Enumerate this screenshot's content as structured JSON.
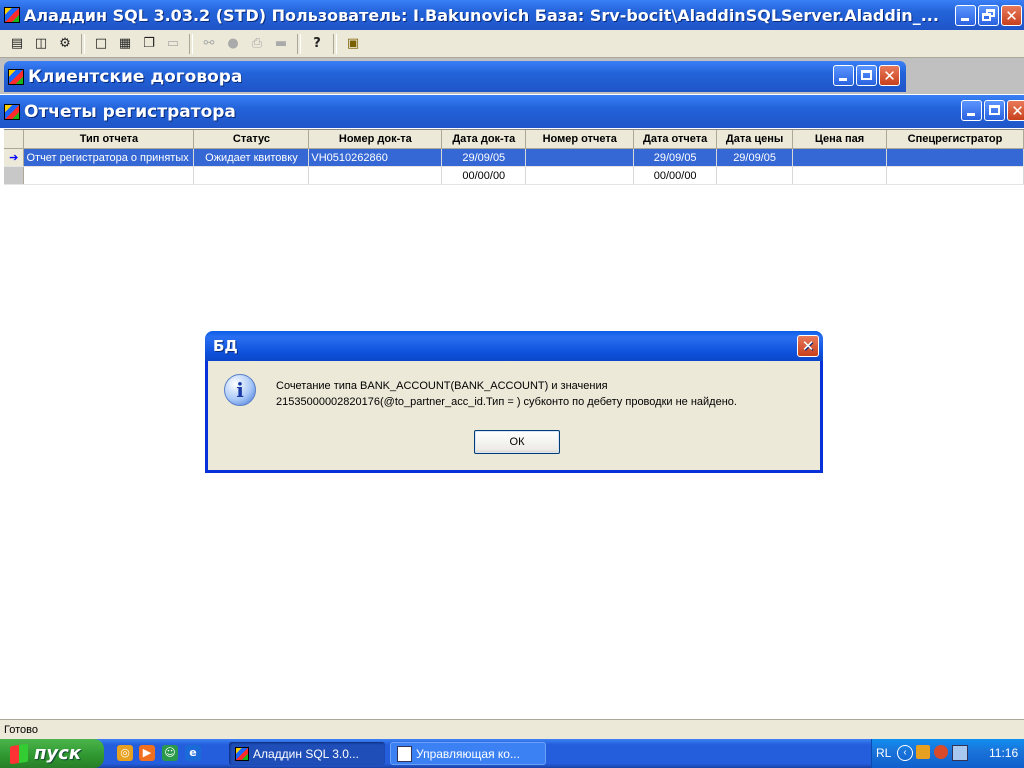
{
  "app": {
    "title": "Аладдин SQL 3.03.2 (STD)  Пользователь: I.Bakunovich База: Srv-bocit\\AladdinSQLServer.Aladdin_..."
  },
  "toolbar": {
    "icons": [
      "report-icon",
      "open-db-icon",
      "filter-icon",
      "window-icon",
      "tile-icon",
      "cascade-icon",
      "blank-window-icon",
      "binoculars-icon",
      "refresh-icon",
      "print-icon",
      "export-icon",
      "help-icon",
      "module-icon"
    ]
  },
  "windows": {
    "contracts_title": "Клиентские договора",
    "reports_title": "Отчеты регистратора"
  },
  "table": {
    "columns": [
      "Тип отчета",
      "Статус",
      "Номер док-та",
      "Дата док-та",
      "Номер отчета",
      "Дата отчета",
      "Дата цены",
      "Цена пая",
      "Спецрегистратор"
    ],
    "rows": [
      [
        "Отчет регистратора о принятых",
        "Ожидает квитовку",
        "VH0510262860",
        "29/09/05",
        "",
        "29/09/05",
        "29/09/05",
        "",
        ""
      ],
      [
        "",
        "",
        "",
        "00/00/00",
        "",
        "00/00/00",
        "",
        "",
        ""
      ]
    ]
  },
  "dialog": {
    "title": "БД",
    "message_line1": "Сочетание типа BANK_ACCOUNT(BANK_ACCOUNT) и значения",
    "message_line2": "21535000002820176(@to_partner_acc_id.Тип = ) субконто по дебету проводки не найдено.",
    "ok_label": "ОК"
  },
  "statusbar": {
    "text": "Готово"
  },
  "taskbar": {
    "start_label": "пуск",
    "tasks": [
      "Аладдин SQL 3.0...",
      "Управляющая ко..."
    ],
    "tray_lang": "RL",
    "clock": "11:16"
  },
  "colors": {
    "selection": "#3568d4",
    "titlebar": "#245edc",
    "dialog_border": "#0831d9"
  }
}
